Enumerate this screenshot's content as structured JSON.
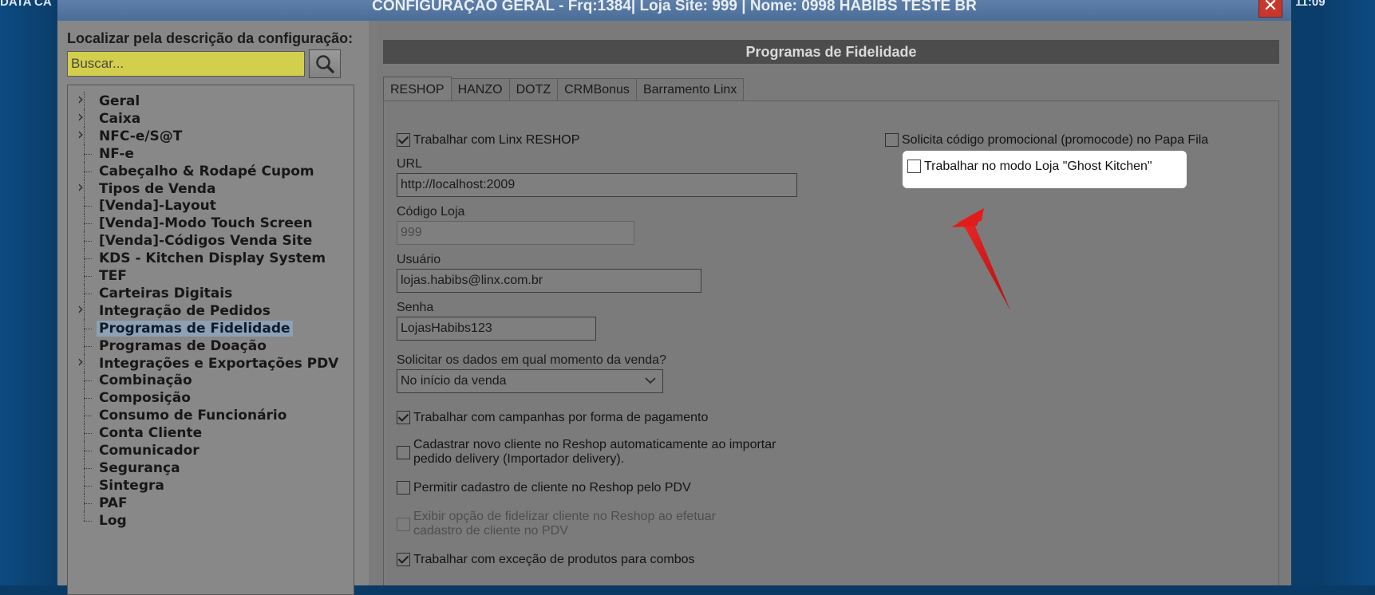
{
  "background": {
    "left_text": "DATA CA",
    "right_text": "11:09"
  },
  "window": {
    "title": "CONFIGURAÇÃO GERAL - Frq:1384| Loja Site: 999 | Nome: 0998 HABIBS TESTE BR",
    "close_icon": "close-icon"
  },
  "left": {
    "search_label": "Localizar pela descrição da configuração:",
    "search_placeholder": "Buscar...",
    "search_value": "",
    "tree": [
      {
        "label": "Geral",
        "expandable": true
      },
      {
        "label": "Caixa",
        "expandable": true
      },
      {
        "label": "NFC-e/S@T",
        "expandable": true
      },
      {
        "label": "NF-e",
        "expandable": false
      },
      {
        "label": "Cabeçalho & Rodapé Cupom",
        "expandable": false
      },
      {
        "label": "Tipos de Venda",
        "expandable": true
      },
      {
        "label": "[Venda]-Layout",
        "expandable": false
      },
      {
        "label": "[Venda]-Modo Touch Screen",
        "expandable": false
      },
      {
        "label": "[Venda]-Códigos Venda Site",
        "expandable": false
      },
      {
        "label": "KDS - Kitchen Display System",
        "expandable": false
      },
      {
        "label": "TEF",
        "expandable": false
      },
      {
        "label": "Carteiras Digitais",
        "expandable": false
      },
      {
        "label": "Integração de Pedidos",
        "expandable": true
      },
      {
        "label": "Programas de Fidelidade",
        "expandable": false,
        "selected": true
      },
      {
        "label": "Programas de Doação",
        "expandable": false
      },
      {
        "label": "Integrações e Exportações PDV",
        "expandable": true
      },
      {
        "label": "Combinação",
        "expandable": false
      },
      {
        "label": "Composição",
        "expandable": false
      },
      {
        "label": "Consumo de Funcionário",
        "expandable": false
      },
      {
        "label": "Conta Cliente",
        "expandable": false
      },
      {
        "label": "Comunicador",
        "expandable": false
      },
      {
        "label": "Segurança",
        "expandable": false
      },
      {
        "label": "Sintegra",
        "expandable": false
      },
      {
        "label": "PAF",
        "expandable": false
      },
      {
        "label": "Log",
        "expandable": false
      }
    ]
  },
  "right": {
    "header": "Programas de Fidelidade",
    "tabs": [
      "RESHOP",
      "HANZO",
      "DOTZ",
      "CRMBonus",
      "Barramento Linx"
    ],
    "active_tab": "RESHOP",
    "form": {
      "work_linx_reshop": {
        "label": "Trabalhar com Linx RESHOP",
        "checked": true
      },
      "url_label": "URL",
      "url_value": "http://localhost:2009",
      "codigo_loja_label": "Código Loja",
      "codigo_loja_value": "999",
      "usuario_label": "Usuário",
      "usuario_value": "lojas.habibs@linx.com.br",
      "senha_label": "Senha",
      "senha_value": "LojasHabibs123",
      "solicitar_label": "Solicitar os dados em qual momento da venda?",
      "solicitar_value": "No início da venda",
      "campanhas": {
        "label": "Trabalhar com campanhas por forma de pagamento",
        "checked": true
      },
      "cadastrar_line1": "Cadastrar novo cliente no Reshop automaticamente ao importar",
      "cadastrar_line2": "pedido delivery (Importador delivery).",
      "cadastrar_checked": false,
      "permitir": {
        "label": "Permitir cadastro de cliente no Reshop pelo PDV",
        "checked": false
      },
      "exibir_line1": "Exibir opção de fidelizar cliente no Reshop ao efetuar",
      "exibir_line2": "cadastro de cliente no PDV",
      "exibir_checked": false,
      "excecao": {
        "label": "Trabalhar com exceção de produtos para combos",
        "checked": true
      },
      "promocode": {
        "label": "Solicita código promocional (promocode) no Papa Fila",
        "checked": false
      },
      "ghost_kitchen": {
        "label": "Trabalhar no modo Loja \"Ghost Kitchen\"",
        "checked": false
      }
    }
  },
  "colors": {
    "arrow": "#e21b1b",
    "search_bg": "#d3cf4c",
    "close_btn": "#c9372c"
  }
}
